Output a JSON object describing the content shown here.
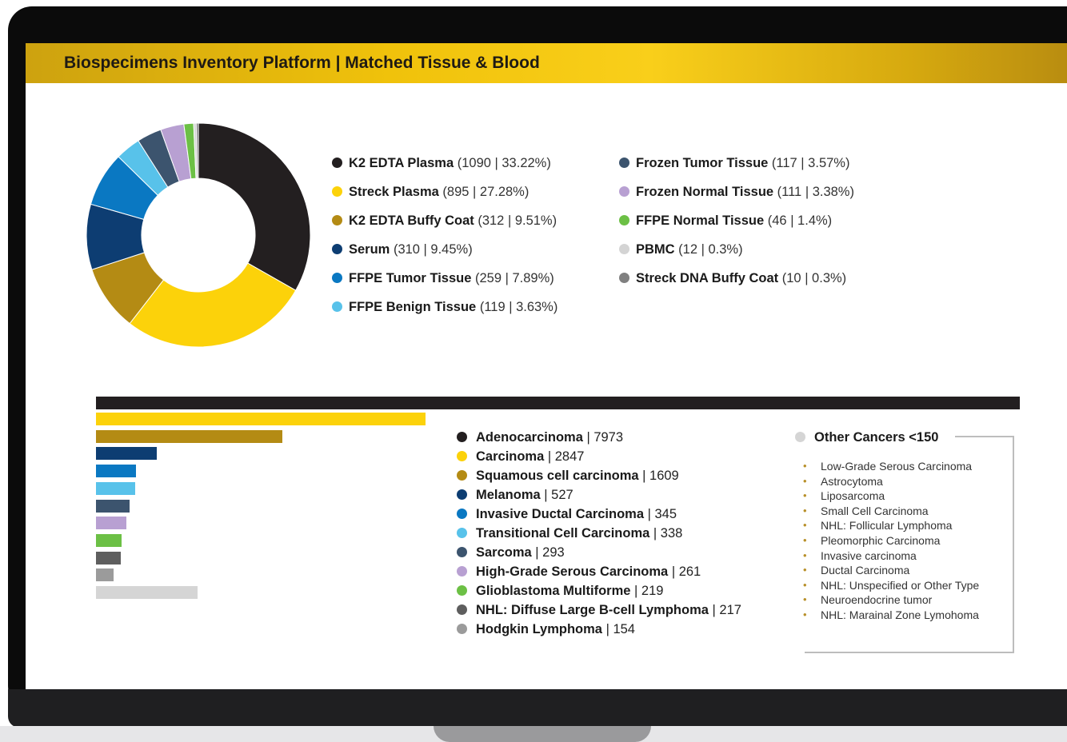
{
  "header": {
    "title": "Biospecimens Inventory Platform | Matched Tissue & Blood"
  },
  "chart_data": [
    {
      "type": "pie",
      "title": "",
      "categories": [
        "K2 EDTA Plasma",
        "Streck Plasma",
        "K2 EDTA Buffy Coat",
        "Serum",
        "FFPE Tumor Tissue",
        "FFPE Benign Tissue",
        "Frozen Tumor Tissue",
        "Frozen Normal Tissue",
        "FFPE Normal Tissue",
        "PBMC",
        "Streck DNA Buffy Coat"
      ],
      "values": [
        1090,
        895,
        312,
        310,
        259,
        119,
        117,
        111,
        46,
        12,
        10
      ],
      "details": [
        "(1090 | 33.22%)",
        "(895 | 27.28%)",
        "(312 | 9.51%)",
        "(310 | 9.45%)",
        "(259 | 7.89%)",
        "(119 | 3.63%)",
        "(117 | 3.57%)",
        "(111 | 3.38%)",
        "(46 | 1.4%)",
        "(12 | 0.3%)",
        "(10 | 0.3%)"
      ],
      "colors": [
        "#231f20",
        "#fcd20a",
        "#b48b14",
        "#0d3d72",
        "#0a78c2",
        "#58c2ea",
        "#3c546e",
        "#b8a0d2",
        "#6cc045",
        "#d4d4d4",
        "#808080"
      ]
    },
    {
      "type": "bar",
      "title": "",
      "categories": [
        "Adenocarcinoma",
        "Carcinoma",
        "Squamous cell carcinoma",
        "Melanoma",
        "Invasive Ductal Carcinoma",
        "Transitional Cell Carcinoma",
        "Sarcoma",
        "High-Grade Serous Carcinoma",
        "Glioblastoma Multiforme",
        "NHL: Diffuse Large B-cell Lymphoma",
        "Hodgkin Lymphoma",
        "Other Cancers <150"
      ],
      "values": [
        7973,
        2847,
        1609,
        527,
        345,
        338,
        293,
        261,
        219,
        217,
        154,
        null
      ],
      "labels": [
        "| 7973",
        "| 2847",
        "| 1609",
        "| 527",
        "| 345",
        "| 338",
        "| 293",
        "| 261",
        "| 219",
        "| 217",
        "| 154",
        ""
      ],
      "colors": [
        "#231f20",
        "#fcd20a",
        "#b48b14",
        "#0d3d72",
        "#0a78c2",
        "#58c2ea",
        "#3c546e",
        "#b8a0d2",
        "#6cc045",
        "#5e5e5e",
        "#9b9b9b",
        "#d5d5d5"
      ]
    }
  ],
  "other_cancers": {
    "title": "Other Cancers <150",
    "items": [
      "Low-Grade Serous Carcinoma",
      "Astrocytoma",
      "Liposarcoma",
      "Small Cell Carcinoma",
      "NHL: Follicular Lymphoma",
      "Pleomorphic Carcinoma",
      "Invasive carcinoma",
      "Ductal Carcinoma",
      "NHL: Unspecified or Other Type",
      "Neuroendocrine tumor",
      "NHL: Marainal Zone Lymohoma"
    ]
  }
}
